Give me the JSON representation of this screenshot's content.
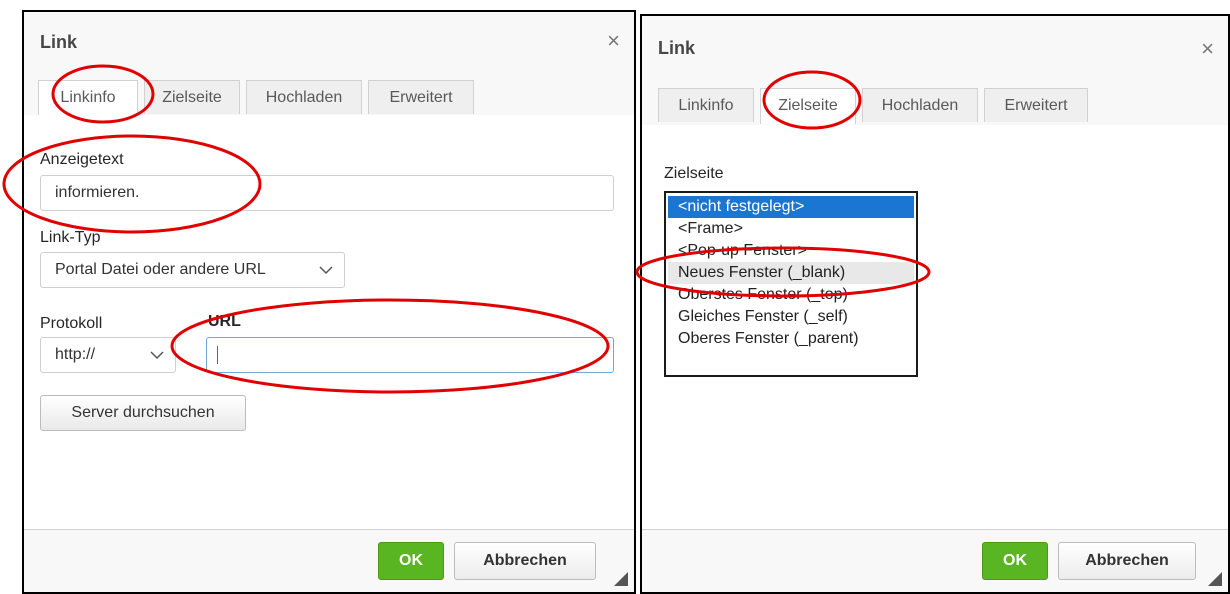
{
  "left": {
    "title": "Link",
    "close_icon": "×",
    "tabs": [
      "Linkinfo",
      "Zielseite",
      "Hochladen",
      "Erweitert"
    ],
    "display_text_label": "Anzeigetext",
    "display_text_value": "informieren.",
    "link_type_label": "Link-Typ",
    "link_type_value": "Portal Datei oder andere URL",
    "protocol_label": "Protokoll",
    "protocol_value": "http://",
    "url_label": "URL",
    "url_value": "",
    "browse_button": "Server durchsuchen",
    "ok_button": "OK",
    "cancel_button": "Abbrechen"
  },
  "right": {
    "title": "Link",
    "close_icon": "×",
    "tabs": [
      "Linkinfo",
      "Zielseite",
      "Hochladen",
      "Erweitert"
    ],
    "target_label": "Zielseite",
    "target_options": [
      "<nicht festgelegt>",
      "<Frame>",
      "<Pop-up Fenster>",
      "Neues Fenster (_blank)",
      "Oberstes Fenster (_top)",
      "Gleiches Fenster (_self)",
      "Oberes Fenster (_parent)"
    ],
    "selected_option": "<nicht festgelegt>",
    "ok_button": "OK",
    "cancel_button": "Abbrechen"
  },
  "colors": {
    "annotation_red": "#e00000",
    "ok_green": "#5ab523",
    "selection_blue": "#1a76d2"
  },
  "icons": {
    "close": "close-icon",
    "chevron": "chevron-down-icon",
    "resize": "resize-grip-icon"
  }
}
